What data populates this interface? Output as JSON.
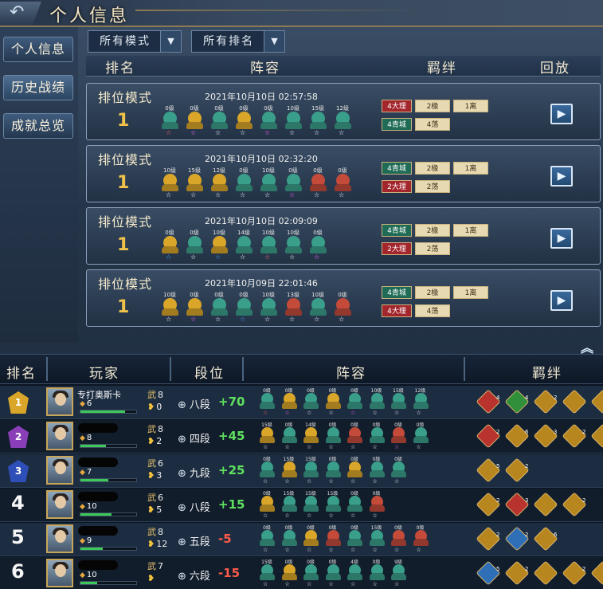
{
  "header": {
    "back_icon": "back-arrow-icon",
    "title": "个人信息"
  },
  "sidebar": {
    "items": [
      {
        "label": "个人信息",
        "active": false
      },
      {
        "label": "历史战绩",
        "active": true
      },
      {
        "label": "成就总览",
        "active": false
      }
    ]
  },
  "filters": {
    "mode": {
      "value": "所有模式",
      "arrow": "▼"
    },
    "rank": {
      "value": "所有排名",
      "arrow": "▼"
    }
  },
  "history": {
    "columns": {
      "rank": "排名",
      "lineup": "阵容",
      "bonds": "羁绊",
      "replay": "回放"
    },
    "matches": [
      {
        "mode": "排位模式",
        "rank": "1",
        "datetime": "2021年10月10日   02:57:58",
        "heroes": [
          {
            "level": "0级",
            "color": "#3a9f8a",
            "star": "#ff6b6b"
          },
          {
            "level": "0级",
            "color": "#d9a62a",
            "star": "#ff66ff"
          },
          {
            "level": "0级",
            "color": "#3a9f8a",
            "star": "#ffffff"
          },
          {
            "level": "0级",
            "color": "#d9a62a",
            "star": "#ffffff"
          },
          {
            "level": "0级",
            "color": "#3a9f8a",
            "star": "#ff66ff"
          },
          {
            "level": "10级",
            "color": "#3a9f8a",
            "star": "#ffffff"
          },
          {
            "level": "15级",
            "color": "#3a9f8a",
            "star": "#ffffff"
          },
          {
            "level": "12级",
            "color": "#3a9f8a",
            "star": "#ffffff"
          }
        ],
        "bonds": [
          [
            {
              "t": "4大理",
              "k": "r"
            },
            {
              "t": "2椽",
              "k": "t"
            },
            {
              "t": "1离",
              "k": "t"
            }
          ],
          [
            {
              "t": "4青城",
              "k": "g"
            },
            {
              "t": "4荡",
              "k": "t"
            }
          ]
        ]
      },
      {
        "mode": "排位模式",
        "rank": "1",
        "datetime": "2021年10月10日   02:32:20",
        "heroes": [
          {
            "level": "10级",
            "color": "#d9a62a",
            "star": "#ffffff"
          },
          {
            "level": "15级",
            "color": "#d9a62a",
            "star": "#ffffff"
          },
          {
            "level": "12级",
            "color": "#d9a62a",
            "star": "#ffffff"
          },
          {
            "level": "0级",
            "color": "#3a9f8a",
            "star": "#ffffff"
          },
          {
            "level": "10级",
            "color": "#3a9f8a",
            "star": "#ffffff"
          },
          {
            "level": "0级",
            "color": "#3a9f8a",
            "star": "#ff66ff"
          },
          {
            "level": "0级",
            "color": "#c44a3a",
            "star": "#ffffff"
          },
          {
            "level": "0级",
            "color": "#c44a3a",
            "star": "#ffffff"
          }
        ],
        "bonds": [
          [
            {
              "t": "4青城",
              "k": "g"
            },
            {
              "t": "2椽",
              "k": "t"
            },
            {
              "t": "1离",
              "k": "t"
            }
          ],
          [
            {
              "t": "2大理",
              "k": "r"
            },
            {
              "t": "2荡",
              "k": "t"
            }
          ]
        ]
      },
      {
        "mode": "排位模式",
        "rank": "1",
        "datetime": "2021年10月10日   02:09:09",
        "heroes": [
          {
            "level": "0级",
            "color": "#d9a62a",
            "star": "#3aa0ff"
          },
          {
            "level": "0级",
            "color": "#3a9f8a",
            "star": "#ffffff"
          },
          {
            "level": "10级",
            "color": "#d9a62a",
            "star": "#3aa0ff"
          },
          {
            "level": "14级",
            "color": "#3a9f8a",
            "star": "#ffffff"
          },
          {
            "level": "10级",
            "color": "#3a9f8a",
            "star": "#ff6b6b"
          },
          {
            "level": "10级",
            "color": "#3a9f8a",
            "star": "#ffffff"
          },
          {
            "level": "0级",
            "color": "#3a9f8a",
            "star": "#ff66ff"
          }
        ],
        "bonds": [
          [
            {
              "t": "4青城",
              "k": "g"
            },
            {
              "t": "2椽",
              "k": "t"
            },
            {
              "t": "1离",
              "k": "t"
            }
          ],
          [
            {
              "t": "2大理",
              "k": "r"
            },
            {
              "t": "2荡",
              "k": "t"
            }
          ]
        ]
      },
      {
        "mode": "排位模式",
        "rank": "1",
        "datetime": "2021年10月09日   22:01:46",
        "heroes": [
          {
            "level": "10级",
            "color": "#d9a62a",
            "star": "#ffffff"
          },
          {
            "level": "0级",
            "color": "#d9a62a",
            "star": "#ff66ff"
          },
          {
            "level": "0级",
            "color": "#3a9f8a",
            "star": "#ffffff"
          },
          {
            "level": "0级",
            "color": "#3a9f8a",
            "star": "#3aa0ff"
          },
          {
            "level": "10级",
            "color": "#3a9f8a",
            "star": "#ffffff"
          },
          {
            "level": "13级",
            "color": "#c44a3a",
            "star": "#ffffff"
          },
          {
            "level": "10级",
            "color": "#3a9f8a",
            "star": "#ffffff"
          },
          {
            "level": "0级",
            "color": "#c44a3a",
            "star": "#ffffff"
          }
        ],
        "bonds": [
          [
            {
              "t": "4青城",
              "k": "g"
            },
            {
              "t": "2椽",
              "k": "t"
            },
            {
              "t": "1离",
              "k": "t"
            }
          ],
          [
            {
              "t": "4大理",
              "k": "r"
            },
            {
              "t": "4荡",
              "k": "t"
            }
          ]
        ]
      }
    ]
  },
  "match_detail": {
    "collapse_icon": "double-chevron-up-icon",
    "columns": {
      "rank": "排名",
      "player": "玩家",
      "tier": "段位",
      "lineup": "阵容",
      "bonds": "羁绊"
    },
    "players": [
      {
        "place": "1",
        "medal": "#d9a62a",
        "name": "专打奥斯卡",
        "level": "6",
        "xp": 0.8,
        "wu": "8",
        "kills": "0",
        "tier": "八段",
        "delta": "+70",
        "dir": "up",
        "heroes": [
          {
            "level": "0级",
            "color": "#3a9f8a",
            "star": "#ff6b6b"
          },
          {
            "level": "0级",
            "color": "#d9a62a",
            "star": "#ff66ff"
          },
          {
            "level": "0级",
            "color": "#3a9f8a",
            "star": "#ffffff"
          },
          {
            "level": "0级",
            "color": "#d9a62a",
            "star": "#ffffff"
          },
          {
            "level": "0级",
            "color": "#3a9f8a",
            "star": "#ff66ff"
          },
          {
            "level": "10级",
            "color": "#3a9f8a",
            "star": "#ffffff"
          },
          {
            "level": "15级",
            "color": "#3a9f8a",
            "star": "#ffffff"
          },
          {
            "level": "12级",
            "color": "#3a9f8a",
            "star": "#ffffff"
          }
        ],
        "synergies": [
          {
            "n": "4",
            "c": "#b8322e"
          },
          {
            "n": "4",
            "c": "#2f8f3a"
          },
          {
            "n": "2",
            "c": "#b8861e"
          },
          {
            "n": "",
            "c": "#b8861e"
          },
          {
            "n": "",
            "c": "#b8861e"
          },
          {
            "n": "",
            "c": "#b8861e"
          }
        ]
      },
      {
        "place": "2",
        "medal": "#8a3fb8",
        "name": "",
        "level": "8",
        "xp": 0.45,
        "wu": "8",
        "kills": "2",
        "tier": "四段",
        "delta": "+45",
        "dir": "up",
        "heroes": [
          {
            "level": "15级",
            "color": "#d9a62a",
            "star": "#ffffff"
          },
          {
            "level": "0级",
            "color": "#3a9f8a",
            "star": "#ffffff"
          },
          {
            "level": "14级",
            "color": "#d9a62a",
            "star": "#ffffff"
          },
          {
            "level": "0级",
            "color": "#3a9f8a",
            "star": "#ffffff"
          },
          {
            "level": "0级",
            "color": "#c44a3a",
            "star": "#ffffff"
          },
          {
            "level": "0级",
            "color": "#3a9f8a",
            "star": "#ffffff"
          },
          {
            "level": "0级",
            "color": "#c44a3a",
            "star": "#ff66ff"
          },
          {
            "level": "0级",
            "color": "#3a9f8a",
            "star": "#ffffff"
          }
        ],
        "synergies": [
          {
            "n": "2",
            "c": "#b8322e"
          },
          {
            "n": "6",
            "c": "#b8861e"
          },
          {
            "n": "3",
            "c": "#b8861e"
          },
          {
            "n": "2",
            "c": "#b8861e"
          },
          {
            "n": "",
            "c": "#b8861e"
          }
        ]
      },
      {
        "place": "3",
        "medal": "#2f4fb8",
        "name": "",
        "level": "7",
        "xp": 0.5,
        "wu": "6",
        "kills": "3",
        "tier": "九段",
        "delta": "+25",
        "dir": "up",
        "heroes": [
          {
            "level": "0级",
            "color": "#3a9f8a",
            "star": "#ffffff"
          },
          {
            "level": "15级",
            "color": "#d9a62a",
            "star": "#ffffff"
          },
          {
            "level": "15级",
            "color": "#3a9f8a",
            "star": "#ffffff"
          },
          {
            "level": "0级",
            "color": "#3a9f8a",
            "star": "#ffffff"
          },
          {
            "level": "0级",
            "color": "#d9a62a",
            "star": "#ffffff"
          },
          {
            "level": "0级",
            "color": "#3a9f8a",
            "star": "#ffffff"
          },
          {
            "level": "0级",
            "color": "#3a9f8a",
            "star": "#ffffff"
          }
        ],
        "synergies": [
          {
            "n": "5",
            "c": "#b8861e"
          },
          {
            "n": "2",
            "c": "#b8861e"
          }
        ]
      },
      {
        "place": "4",
        "medal": "",
        "name": "",
        "level": "10",
        "xp": 0.55,
        "wu": "6",
        "kills": "5",
        "tier": "八段",
        "delta": "+15",
        "dir": "up",
        "heroes": [
          {
            "level": "0级",
            "color": "#d9a62a",
            "star": "#ffffff"
          },
          {
            "level": "15级",
            "color": "#3a9f8a",
            "star": "#ffffff"
          },
          {
            "level": "15级",
            "color": "#3a9f8a",
            "star": "#ffffff"
          },
          {
            "level": "15级",
            "color": "#3a9f8a",
            "star": "#ffffff"
          },
          {
            "level": "0级",
            "color": "#3a9f8a",
            "star": "#ffffff"
          },
          {
            "level": "0级",
            "color": "#c44a3a",
            "star": "#ffffff"
          }
        ],
        "synergies": [
          {
            "n": "2",
            "c": "#b8861e"
          },
          {
            "n": "3",
            "c": "#b8322e"
          },
          {
            "n": "",
            "c": "#b8861e"
          },
          {
            "n": "2",
            "c": "#b8861e"
          }
        ]
      },
      {
        "place": "5",
        "medal": "",
        "name": "",
        "level": "9",
        "xp": 0.4,
        "wu": "8",
        "kills": "12",
        "tier": "五段",
        "delta": "-5",
        "dir": "down",
        "heroes": [
          {
            "level": "0级",
            "color": "#3a9f8a",
            "star": "#ffffff"
          },
          {
            "level": "0级",
            "color": "#3a9f8a",
            "star": "#ffffff"
          },
          {
            "level": "0级",
            "color": "#d9a62a",
            "star": "#ffffff"
          },
          {
            "level": "0级",
            "color": "#c44a3a",
            "star": "#ffffff"
          },
          {
            "level": "0级",
            "color": "#3a9f8a",
            "star": "#ffffff"
          },
          {
            "level": "15级",
            "color": "#3a9f8a",
            "star": "#ffffff"
          },
          {
            "level": "0级",
            "color": "#c44a3a",
            "star": "#ffffff"
          },
          {
            "level": "0级",
            "color": "#c44a3a",
            "star": "#ffffff"
          }
        ],
        "synergies": [
          {
            "n": "2",
            "c": "#b8861e"
          },
          {
            "n": "2",
            "c": "#2f6fb8"
          },
          {
            "n": "6",
            "c": "#b8861e"
          }
        ]
      },
      {
        "place": "6",
        "medal": "",
        "name": "",
        "level": "10",
        "xp": 0.3,
        "wu": "7",
        "kills": "",
        "tier": "六段",
        "delta": "-15",
        "dir": "down",
        "heroes": [
          {
            "level": "15级",
            "color": "#3a9f8a",
            "star": "#ffffff"
          },
          {
            "level": "0级",
            "color": "#d9a62a",
            "star": "#ffffff"
          },
          {
            "level": "0级",
            "color": "#3a9f8a",
            "star": "#ffffff"
          },
          {
            "level": "0级",
            "color": "#3a9f8a",
            "star": "#ffffff"
          },
          {
            "level": "4级",
            "color": "#3a9f8a",
            "star": "#ffffff"
          },
          {
            "level": "0级",
            "color": "#3a9f8a",
            "star": "#ffffff"
          },
          {
            "level": "9级",
            "color": "#3a9f8a",
            "star": "#ffffff"
          }
        ],
        "synergies": [
          {
            "n": "5",
            "c": "#2f6fb8"
          },
          {
            "n": "2",
            "c": "#b8861e"
          },
          {
            "n": "",
            "c": "#b8861e"
          },
          {
            "n": "2",
            "c": "#b8861e"
          },
          {
            "n": "",
            "c": "#b8861e"
          }
        ]
      }
    ]
  }
}
